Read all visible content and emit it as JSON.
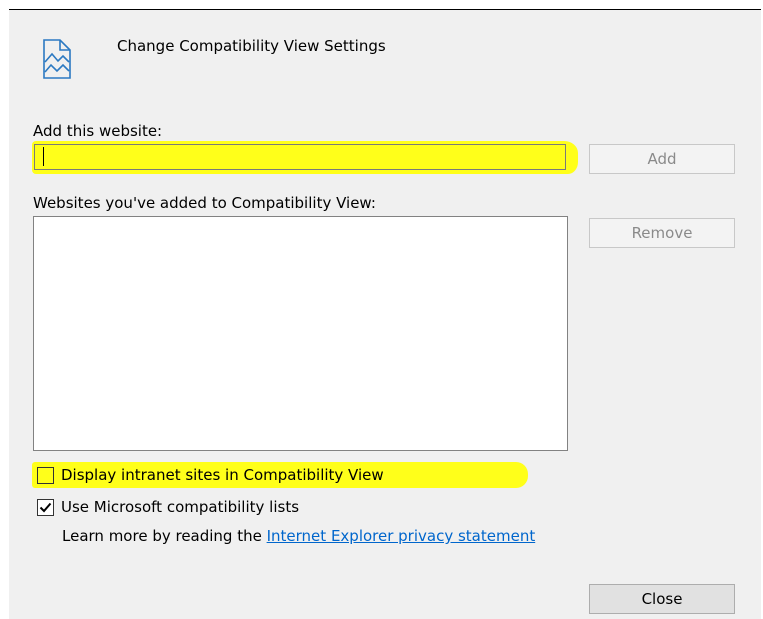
{
  "dialog": {
    "title": "Change Compatibility View Settings",
    "icon": "compatibility-view-icon"
  },
  "add_section": {
    "label": "Add this website:",
    "input_value": "",
    "add_button": "Add"
  },
  "sites_section": {
    "label": "Websites you've added to Compatibility View:",
    "items": [],
    "remove_button": "Remove"
  },
  "options": {
    "intranet": {
      "label": "Display intranet sites in Compatibility View",
      "checked": false
    },
    "ms_lists": {
      "label": "Use Microsoft compatibility lists",
      "checked": true
    }
  },
  "learn_more": {
    "text": "Learn more by reading the ",
    "link": "Internet Explorer privacy statement"
  },
  "footer": {
    "close_button": "Close"
  },
  "colors": {
    "highlight": "#ffff1a",
    "link": "#0066cc",
    "dialog_bg": "#f0f0f0"
  }
}
